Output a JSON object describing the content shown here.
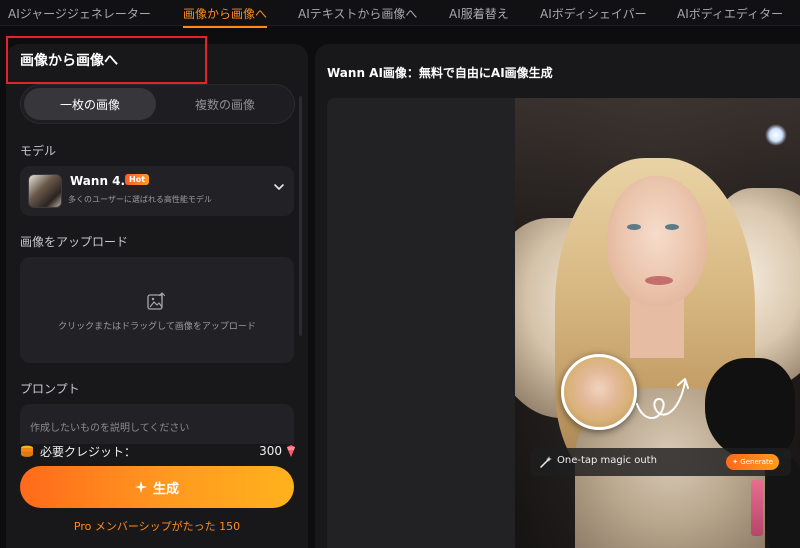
{
  "nav": {
    "tabs": [
      {
        "label": "AIジャージジェネレーター",
        "active": false
      },
      {
        "label": "画像から画像へ",
        "active": true
      },
      {
        "label": "AIテキストから画像へ",
        "active": false
      },
      {
        "label": "AI服着替え",
        "active": false
      },
      {
        "label": "AIボディシェイパー",
        "active": false
      },
      {
        "label": "AIボディエディター",
        "active": false
      }
    ]
  },
  "panel": {
    "title": "画像から画像へ",
    "mode_single": "一枚の画像",
    "mode_multiple": "複数の画像",
    "model_label": "モデル",
    "model": {
      "name": "Wann 4.0",
      "badge": "Hot",
      "description": "多くのユーザーに選ばれる高性能モデル"
    },
    "upload_label": "画像をアップロード",
    "upload_hint": "クリックまたはドラッグして画像をアップロード",
    "prompt_label": "プロンプト",
    "prompt_placeholder": "作成したいものを説明してください",
    "credits_label": "必要クレジット：",
    "credits_value": "300",
    "generate_label": "生成",
    "pro_text": "Pro メンバーシップがたった 150"
  },
  "preview": {
    "title": "Wann AI画像：無料で自由にAI画像生成",
    "magic_text": "One-tap magic outh",
    "magic_button": "Generate"
  },
  "colors": {
    "accent": "#ff8a1f",
    "highlight_box": "#e2242a"
  },
  "icons": {
    "chevron": "chevron-down-icon",
    "upload": "image-upload-icon",
    "credits": "coin-stack-icon",
    "gem": "gem-icon",
    "sparkle": "sparkle-icon"
  }
}
